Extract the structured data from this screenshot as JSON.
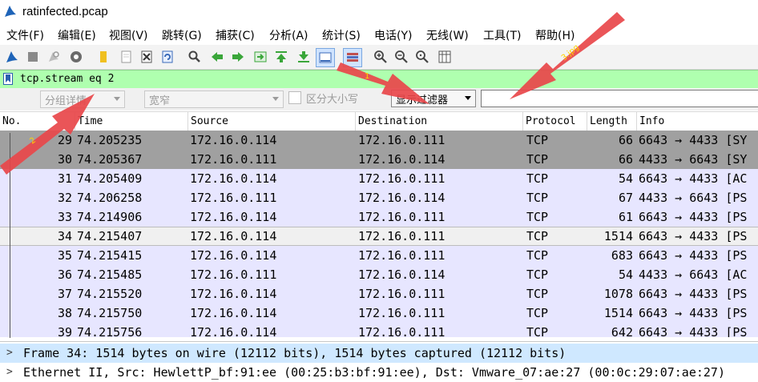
{
  "window": {
    "title": "ratinfected.pcap"
  },
  "menu": [
    "文件(F)",
    "编辑(E)",
    "视图(V)",
    "跳转(G)",
    "捕获(C)",
    "分析(A)",
    "统计(S)",
    "电话(Y)",
    "无线(W)",
    "工具(T)",
    "帮助(H)"
  ],
  "toolbar": {
    "icons": [
      "start-capture-icon",
      "stop-capture-icon",
      "restart-capture-icon",
      "capture-options-icon",
      "open-file-icon",
      "save-file-icon",
      "close-file-icon",
      "reload-file-icon",
      "find-packet-icon",
      "go-back-icon",
      "go-forward-icon",
      "go-to-packet-icon",
      "go-first-icon",
      "go-last-icon",
      "auto-scroll-icon",
      "colorize-icon",
      "zoom-in-icon",
      "zoom-out-icon",
      "normal-size-icon",
      "resize-columns-icon"
    ]
  },
  "display_filter": {
    "value": "tcp.stream eq 2"
  },
  "search_bar": {
    "search_in": "分组详情",
    "char_width": "宽窄",
    "case_label": "区分大小写",
    "search_type": "显示过滤器",
    "search_value": ""
  },
  "columns": [
    "No.",
    "Time",
    "Source",
    "Destination",
    "Protocol",
    "Length",
    "Info"
  ],
  "packets": [
    {
      "no": "29",
      "time": "74.205235",
      "src": "172.16.0.114",
      "dst": "172.16.0.111",
      "proto": "TCP",
      "len": "66",
      "info": "6643 → 4433 [SY",
      "style": "gray"
    },
    {
      "no": "30",
      "time": "74.205367",
      "src": "172.16.0.111",
      "dst": "172.16.0.114",
      "proto": "TCP",
      "len": "66",
      "info": "4433 → 6643 [SY",
      "style": "gray"
    },
    {
      "no": "31",
      "time": "74.205409",
      "src": "172.16.0.114",
      "dst": "172.16.0.111",
      "proto": "TCP",
      "len": "54",
      "info": "6643 → 4433 [AC",
      "style": "lav"
    },
    {
      "no": "32",
      "time": "74.206258",
      "src": "172.16.0.111",
      "dst": "172.16.0.114",
      "proto": "TCP",
      "len": "67",
      "info": "4433 → 6643 [PS",
      "style": "lav"
    },
    {
      "no": "33",
      "time": "74.214906",
      "src": "172.16.0.114",
      "dst": "172.16.0.111",
      "proto": "TCP",
      "len": "61",
      "info": "6643 → 4433 [PS",
      "style": "lav"
    },
    {
      "no": "34",
      "time": "74.215407",
      "src": "172.16.0.114",
      "dst": "172.16.0.111",
      "proto": "TCP",
      "len": "1514",
      "info": "6643 → 4433 [PS",
      "style": "sel"
    },
    {
      "no": "35",
      "time": "74.215415",
      "src": "172.16.0.114",
      "dst": "172.16.0.111",
      "proto": "TCP",
      "len": "683",
      "info": "6643 → 4433 [PS",
      "style": "lav"
    },
    {
      "no": "36",
      "time": "74.215485",
      "src": "172.16.0.111",
      "dst": "172.16.0.114",
      "proto": "TCP",
      "len": "54",
      "info": "4433 → 6643 [AC",
      "style": "lav"
    },
    {
      "no": "37",
      "time": "74.215520",
      "src": "172.16.0.114",
      "dst": "172.16.0.111",
      "proto": "TCP",
      "len": "1078",
      "info": "6643 → 4433 [PS",
      "style": "lav"
    },
    {
      "no": "38",
      "time": "74.215750",
      "src": "172.16.0.114",
      "dst": "172.16.0.111",
      "proto": "TCP",
      "len": "1514",
      "info": "6643 → 4433 [PS",
      "style": "lav"
    },
    {
      "no": "39",
      "time": "74.215756",
      "src": "172.16.0.114",
      "dst": "172.16.0.111",
      "proto": "TCP",
      "len": "642",
      "info": "6643 → 4433 [PS",
      "style": "lav"
    }
  ],
  "details": [
    {
      "text": "Frame 34: 1514 bytes on wire (12112 bits), 1514 bytes captured (12112 bits)",
      "selected": true
    },
    {
      "text": "Ethernet II, Src: HewlettP_bf:91:ee (00:25:b3:bf:91:ee), Dst: Vmware_07:ae:27 (00:0c:29:07:ae:27)",
      "selected": false
    }
  ],
  "annotations": [
    "1",
    "2",
    "3.jpg"
  ],
  "colors": {
    "filter_bg": "#afffaf",
    "row_gray": "#a0a0a0",
    "row_lav": "#e7e6ff",
    "arrow": "#e8474a"
  }
}
